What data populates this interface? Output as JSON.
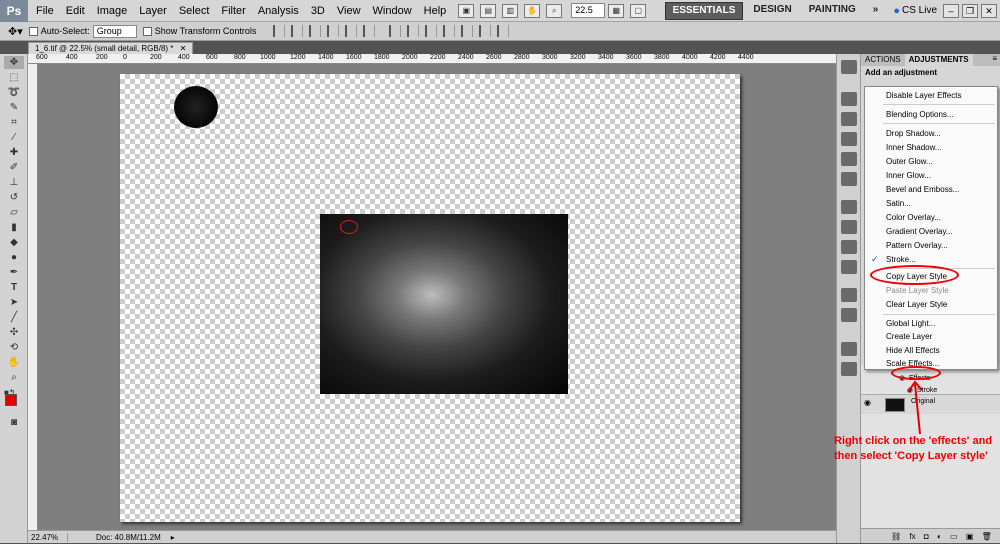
{
  "menubar": {
    "logo": "Ps",
    "items": [
      "File",
      "Edit",
      "Image",
      "Layer",
      "Select",
      "Filter",
      "Analysis",
      "3D",
      "View",
      "Window",
      "Help"
    ],
    "zoom": "22.5",
    "workspaces": [
      "ESSENTIALS",
      "DESIGN",
      "PAINTING"
    ],
    "more": "»",
    "cslive": "CS Live"
  },
  "options": {
    "auto_select_label": "Auto-Select:",
    "auto_select_value": "Group",
    "show_transform": "Show Transform Controls"
  },
  "document": {
    "tab_title": "1_6.tif @ 22.5% (small detail, RGB/8) *",
    "ruler_ticks": [
      "600",
      "400",
      "200",
      "0",
      "200",
      "400",
      "600",
      "800",
      "1000",
      "1200",
      "1400",
      "1600",
      "1800",
      "2000",
      "2200",
      "2400",
      "2600",
      "2800",
      "3000",
      "3200",
      "3400",
      "3600",
      "3800",
      "4000",
      "4200",
      "4400"
    ]
  },
  "status": {
    "zoom": "22.47%",
    "doc": "Doc: 40.8M/11.2M"
  },
  "panel": {
    "tabs": [
      "ACTIONS",
      "ADJUSTMENTS"
    ],
    "title": "Add an adjustment",
    "effects_label": "Effects",
    "stroke_label": "Stroke",
    "layer_name": "Original"
  },
  "context_menu": {
    "items": [
      {
        "label": "Disable Layer Effects",
        "enabled": true
      },
      {
        "label": "Blending Options...",
        "enabled": true
      },
      {
        "label": "Drop Shadow...",
        "enabled": true
      },
      {
        "label": "Inner Shadow...",
        "enabled": true
      },
      {
        "label": "Outer Glow...",
        "enabled": true
      },
      {
        "label": "Inner Glow...",
        "enabled": true
      },
      {
        "label": "Bevel and Emboss...",
        "enabled": true
      },
      {
        "label": "Satin...",
        "enabled": true
      },
      {
        "label": "Color Overlay...",
        "enabled": true
      },
      {
        "label": "Gradient Overlay...",
        "enabled": true
      },
      {
        "label": "Pattern Overlay...",
        "enabled": true
      },
      {
        "label": "Stroke...",
        "enabled": true,
        "checked": true
      },
      {
        "label": "Copy Layer Style",
        "enabled": true
      },
      {
        "label": "Paste Layer Style",
        "enabled": false
      },
      {
        "label": "Clear Layer Style",
        "enabled": true
      },
      {
        "label": "Global Light...",
        "enabled": true
      },
      {
        "label": "Create Layer",
        "enabled": true
      },
      {
        "label": "Hide All Effects",
        "enabled": true
      },
      {
        "label": "Scale Effects...",
        "enabled": true
      }
    ],
    "check_glyph": "✓"
  },
  "annotation": {
    "text": "Right click on the 'effects' and then select 'Copy Layer style'"
  },
  "colors": {
    "foreground": "#e00000",
    "background": "#ffffff",
    "annotation": "#e00000"
  }
}
